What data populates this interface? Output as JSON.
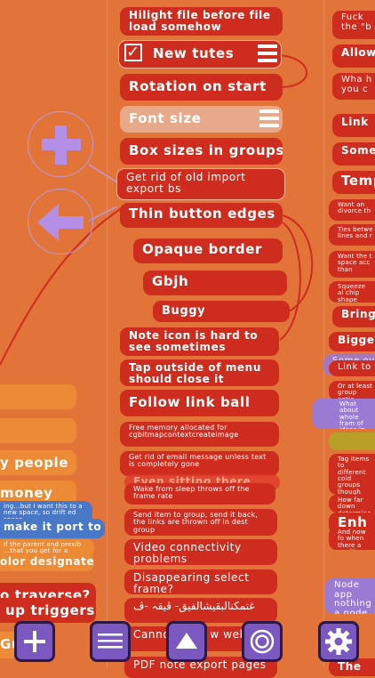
{
  "center": {
    "hilight": "Hilight file before file load somehow",
    "new_tutes": "New tutes",
    "rotation": "Rotation on start",
    "font_size": "Font size",
    "box_sizes": "Box sizes in groups",
    "import_export": "Get rid of old import export bs",
    "thin_edges": "Thin button edges",
    "opaque": "Opaque border",
    "gbjh": "Gbjh",
    "buggy": "Buggy",
    "note_icon": "Note icon is hard to see sometimes",
    "tap_outside": "Tap outside of menu should close it",
    "follow_link": "Follow link ball",
    "free_memory": "Free memory allocated for cgbitmapcontextcreateimage",
    "email_message": "Get rid of email message unless text is completely gone",
    "even_sitting": "Even sitting there",
    "wake_sleep": "Wake from sleep throws off the frame rate",
    "send_item": "Send item to group, send it back, the links are thrown off in dest group",
    "video": "Video connectivity problems",
    "disappearing": "Disappearing select frame?",
    "arabic": "غتمكنالبقيشالفيق- ڤيقہ -ڤ",
    "cannot_start": "Cannot start w weblink",
    "pdf": "PDF note export pages"
  },
  "left": {
    "people": "y people",
    "money": "money",
    "space_note": "ing...but I want this to a new space, so drift ed space",
    "port": "make it port to",
    "if_parent": "if the parent and presib ...that you get for a small",
    "color": "olor designate",
    "traverse": "o traverse?",
    "triggers": "up triggers",
    "gu": "Gu"
  },
  "right": {
    "fuck": "Fuck the \"b",
    "allow": "Allow",
    "wha": "Wha h you c",
    "link": "Link",
    "some": "Some",
    "temp": "Temp",
    "want_an": "Want an divorce th",
    "ties": "Ties betwe lines and r",
    "want_the": "Want the t space acc than",
    "squeeze": "Squeeze al chip shape",
    "bring": "Bring t",
    "bigger": "Bigger",
    "some_ov": "Some ov",
    "link_to": "Link to",
    "at_least": "Or at least group optio",
    "what_about": "What about whole fram of ideas in",
    "tag": "Tag items to different cold groups though And there's colors arrang existing in",
    "how_far": "How far down determine s",
    "enh": "Enh",
    "and_now": "And now fo when there a positive and",
    "node": "Node app nothing a node",
    "the": "The"
  },
  "toolbar": {
    "add": "+",
    "list": "list",
    "up": "up",
    "target": "target",
    "settings": "settings"
  }
}
